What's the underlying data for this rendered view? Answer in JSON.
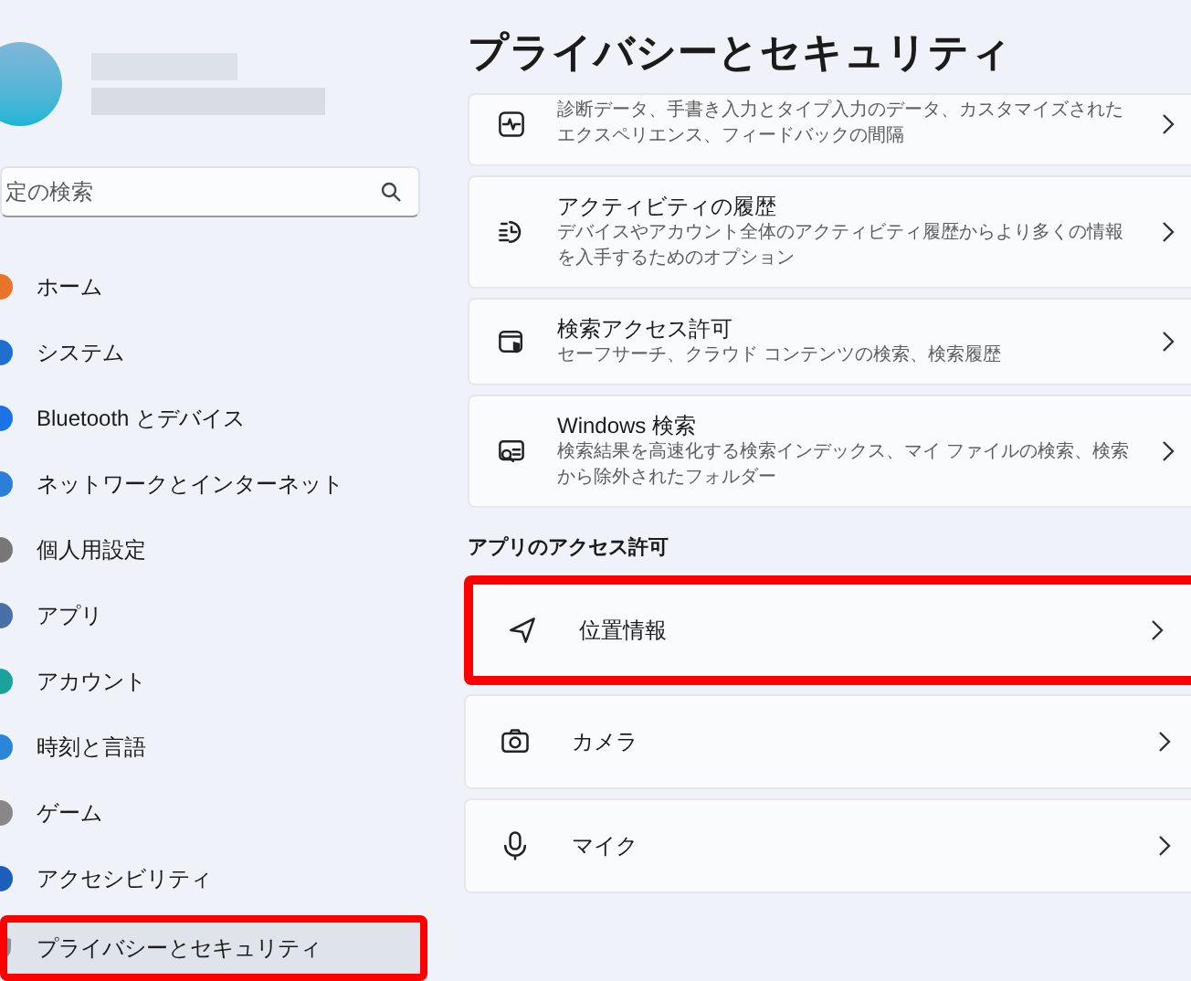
{
  "sidebar": {
    "search": {
      "placeholder": "定の検索"
    },
    "items": [
      {
        "label": "ホーム",
        "selected": false,
        "annotated": false
      },
      {
        "label": "システム",
        "selected": false,
        "annotated": false
      },
      {
        "label": "Bluetooth とデバイス",
        "selected": false,
        "annotated": false
      },
      {
        "label": "ネットワークとインターネット",
        "selected": false,
        "annotated": false
      },
      {
        "label": "個人用設定",
        "selected": false,
        "annotated": false
      },
      {
        "label": "アプリ",
        "selected": false,
        "annotated": false
      },
      {
        "label": "アカウント",
        "selected": false,
        "annotated": false
      },
      {
        "label": "時刻と言語",
        "selected": false,
        "annotated": false
      },
      {
        "label": "ゲーム",
        "selected": false,
        "annotated": false
      },
      {
        "label": "アクセシビリティ",
        "selected": false,
        "annotated": false
      },
      {
        "label": "プライバシーとセキュリティ",
        "selected": true,
        "annotated": true
      }
    ]
  },
  "page": {
    "title": "プライバシーとセキュリティ",
    "cards": [
      {
        "description": "診断データ、手書き入力とタイプ入力のデータ、カスタマイズされたエクスペリエンス、フィードバックの間隔"
      },
      {
        "title": "アクティビティの履歴",
        "description": "デバイスやアカウント全体のアクティビティ履歴からより多くの情報を入手するためのオプション"
      },
      {
        "title": "検索アクセス許可",
        "description": "セーフサーチ、クラウド コンテンツの検索、検索履歴"
      },
      {
        "title": "Windows 検索",
        "description": "検索結果を高速化する検索インデックス、マイ ファイルの検索、検索から除外されたフォルダー"
      }
    ],
    "section_heading": "アプリのアクセス許可",
    "app_permissions": [
      {
        "title": "位置情報",
        "annotated": true
      },
      {
        "title": "カメラ",
        "annotated": false
      },
      {
        "title": "マイク",
        "annotated": false
      }
    ]
  }
}
